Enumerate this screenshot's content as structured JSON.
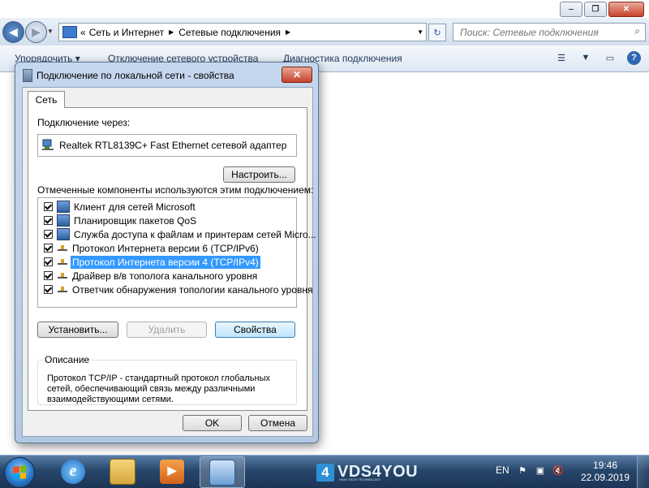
{
  "explorer": {
    "address": {
      "crumb_prefix": "«",
      "crumbs": [
        "Сеть и Интернет",
        "Сетевые подключения"
      ]
    },
    "search": {
      "placeholder": "Поиск: Сетевые подключения"
    },
    "toolbar": {
      "organize": "Упорядочить ▾",
      "disable_device": "Отключение сетевого устройства",
      "diagnose": "Диагностика подключения"
    }
  },
  "dialog": {
    "title": "Подключение по локальной сети - свойства",
    "tab": "Сеть",
    "connect_using_label": "Подключение через:",
    "adapter_name": "Realtek RTL8139C+ Fast Ethernet сетевой адаптер",
    "configure_button": "Настроить...",
    "components_label": "Отмеченные компоненты используются этим подключением:",
    "components": [
      {
        "label": "Клиент для сетей Microsoft",
        "checked": true,
        "icon": "network-client-icon"
      },
      {
        "label": "Планировщик пакетов QoS",
        "checked": true,
        "icon": "qos-icon"
      },
      {
        "label": "Служба доступа к файлам и принтерам сетей Micro...",
        "checked": true,
        "icon": "file-sharing-icon"
      },
      {
        "label": "Протокол Интернета версии 6 (TCP/IPv6)",
        "checked": true,
        "icon": "protocol-icon"
      },
      {
        "label": "Протокол Интернета версии 4 (TCP/IPv4)",
        "checked": true,
        "icon": "protocol-icon",
        "selected": true
      },
      {
        "label": "Драйвер в/в тополога канального уровня",
        "checked": true,
        "icon": "protocol-icon"
      },
      {
        "label": "Ответчик обнаружения топологии канального уровня",
        "checked": true,
        "icon": "protocol-icon"
      }
    ],
    "install_button": "Установить...",
    "uninstall_button": "Удалить",
    "properties_button": "Свойства",
    "description_label": "Описание",
    "description_text": "Протокол TCP/IP - стандартный протокол глобальных сетей, обеспечивающий связь между различными взаимодействующими сетями.",
    "ok_button": "OK",
    "cancel_button": "Отмена"
  },
  "taskbar": {
    "logo_number": "4",
    "logo_text": "VDS4YOU",
    "logo_subtext": "HIGH-TECH TECHNOLOGY",
    "language": "EN",
    "time": "19:46",
    "date": "22.09.2019"
  },
  "colors": {
    "selection": "#3399ff",
    "taskbar": "#27466b",
    "dialog_frame": "#c5d7ee"
  }
}
